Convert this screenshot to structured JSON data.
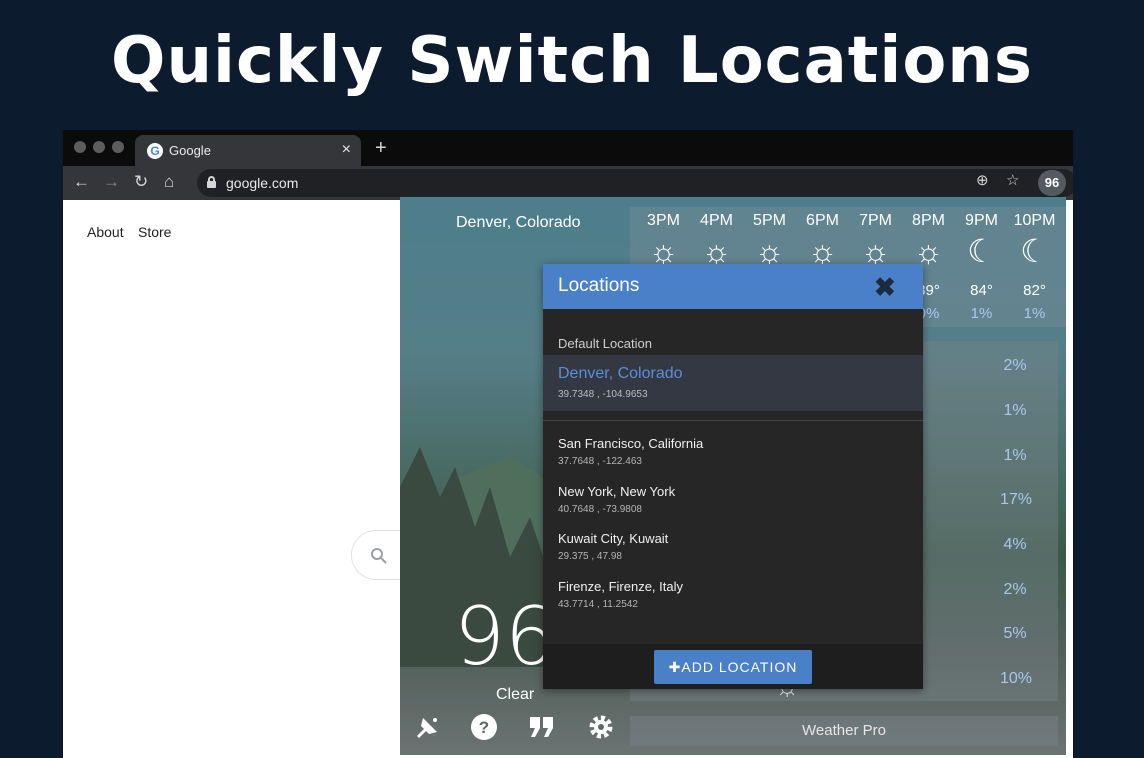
{
  "hero": {
    "title": "Quickly Switch Locations"
  },
  "browser": {
    "tab_title": "Google",
    "tab_close": "×",
    "new_tab": "+",
    "url": "google.com",
    "extension_badge": "96",
    "google_links": [
      "About",
      "Store"
    ]
  },
  "weather": {
    "location": "Denver, Colorado",
    "hourly": [
      {
        "time": "3PM",
        "icon": "sun-icon",
        "glyph": "☼",
        "temp": "",
        "precip": ""
      },
      {
        "time": "4PM",
        "icon": "sun-icon",
        "glyph": "☼",
        "temp": "",
        "precip": ""
      },
      {
        "time": "5PM",
        "icon": "sun-icon",
        "glyph": "☼",
        "temp": "",
        "precip": ""
      },
      {
        "time": "6PM",
        "icon": "sun-icon",
        "glyph": "☼",
        "temp": "",
        "precip": ""
      },
      {
        "time": "7PM",
        "icon": "sun-icon",
        "glyph": "☼",
        "temp": "",
        "precip": ""
      },
      {
        "time": "8PM",
        "icon": "sun-icon",
        "glyph": "☼",
        "temp": "89°",
        "precip": "0%"
      },
      {
        "time": "9PM",
        "icon": "moon-icon",
        "glyph": "☾",
        "temp": "84°",
        "precip": "1%"
      },
      {
        "time": "10PM",
        "icon": "moon-icon",
        "glyph": "☾",
        "temp": "82°",
        "precip": "1%"
      }
    ],
    "daily_precip": [
      "2%",
      "1%",
      "1%",
      "17%",
      "4%",
      "2%",
      "5%",
      "10%"
    ],
    "daily_deg_symbol": "°",
    "current_temp": "96",
    "condition": "Clear",
    "brand": "Weather Pro"
  },
  "dialog": {
    "title": "Locations",
    "close": "✖",
    "default_label": "Default Location",
    "default": {
      "name": "Denver, Colorado",
      "coords": "39.7348 , -104.9653"
    },
    "locations": [
      {
        "name": "San Francisco, California",
        "coords": "37.7648 , -122.463"
      },
      {
        "name": "New York, New York",
        "coords": "40.7648 , -73.9808"
      },
      {
        "name": "Kuwait City, Kuwait",
        "coords": "29.375 , 47.98"
      },
      {
        "name": "Firenze, Firenze, Italy",
        "coords": "43.7714 , 11.2542"
      }
    ],
    "add_button": "✚ADD LOCATION"
  },
  "colors": {
    "accent": "#4a80c8",
    "page_bg": "#0c1b2e",
    "precip": "#a9c8ee"
  }
}
